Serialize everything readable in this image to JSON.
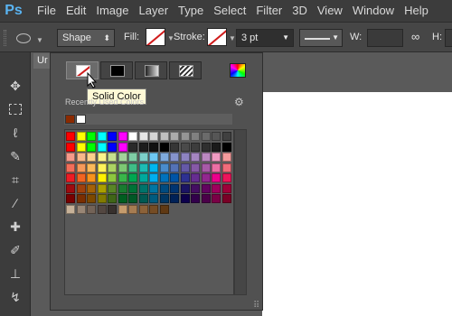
{
  "menubar": {
    "logo": "Ps",
    "items": [
      "File",
      "Edit",
      "Image",
      "Layer",
      "Type",
      "Select",
      "Filter",
      "3D",
      "View",
      "Window",
      "Help"
    ]
  },
  "options": {
    "mode_value": "Shape",
    "fill_label": "Fill:",
    "stroke_label": "Stroke:",
    "stroke_width": "3 pt",
    "w_label": "W:",
    "h_label": "H:"
  },
  "document": {
    "tab_label": "Ur"
  },
  "fill_popup": {
    "fill_types": [
      "No Color",
      "Solid Color",
      "Gradient",
      "Pattern"
    ],
    "tooltip": "Solid Color",
    "recent_label": "Recently Used Colors",
    "recent_colors": [
      "#8b2a00",
      "#ffffff"
    ],
    "swatch_rows": [
      [
        "#ff0000",
        "#ffff00",
        "#00ff00",
        "#00ffff",
        "#0000ff",
        "#ff00ff",
        "#ffffff",
        "#e6e6e6",
        "#d4d4d4",
        "#c0c0c0",
        "#ababab",
        "#959595",
        "#808080",
        "#6b6b6b",
        "#565656",
        "#404040"
      ],
      [
        "#ff0000",
        "#ffff00",
        "#00ff00",
        "#00ffff",
        "#0000ff",
        "#ff00ff",
        "#2a2a2a",
        "#1c1c1c",
        "#111111",
        "#000000",
        "#363636",
        "#4a4a4a",
        "#3d3d3d",
        "#2f2f2f",
        "#1a1a1a",
        "#000000"
      ],
      [
        "#f59a8a",
        "#f8b88a",
        "#fcd18c",
        "#fdf58c",
        "#c7df8f",
        "#a3d49b",
        "#7fcda5",
        "#7ccfc9",
        "#6ec9f4",
        "#7eaadd",
        "#8593cc",
        "#8d83c1",
        "#a485c0",
        "#bb88c0",
        "#f09bc2",
        "#f49b9c"
      ],
      [
        "#f26e5a",
        "#f69a5a",
        "#fbba5a",
        "#fff25a",
        "#acd363",
        "#7dc874",
        "#3fbd87",
        "#1dbcb5",
        "#00b7ef",
        "#4a8ccc",
        "#5472b6",
        "#6559a7",
        "#8659a6",
        "#a75aa7",
        "#eb6fa5",
        "#f06c7a"
      ],
      [
        "#ed1c24",
        "#f26522",
        "#f7941d",
        "#fff200",
        "#8dc63f",
        "#39b54a",
        "#00a651",
        "#00a99d",
        "#00aeef",
        "#0072bc",
        "#0054a6",
        "#2e3192",
        "#662d91",
        "#92278f",
        "#ec008c",
        "#ed145b"
      ],
      [
        "#9e0b0f",
        "#a0410d",
        "#a36209",
        "#aba000",
        "#598527",
        "#197b30",
        "#007236",
        "#00746b",
        "#0076a3",
        "#004b80",
        "#003471",
        "#1b1464",
        "#440e62",
        "#630460",
        "#9e005d",
        "#9e0039"
      ],
      [
        "#790000",
        "#7b2e00",
        "#7d4900",
        "#827b00",
        "#406618",
        "#005e20",
        "#005826",
        "#005952",
        "#005b7f",
        "#003663",
        "#002157",
        "#0d004c",
        "#32004b",
        "#4b0049",
        "#7b0046",
        "#7a0026"
      ],
      [
        "#c7b299",
        "#998675",
        "#736357",
        "#534741",
        "#37302d",
        "#c69c6d",
        "#a67c52",
        "#8c6239",
        "#754c24",
        "#603913"
      ]
    ]
  },
  "colors": {
    "menubar_bg": "#3c3c3c",
    "panel_bg": "#535353",
    "accent_logo": "#5ab4f2",
    "tooltip_bg": "#fff9d6"
  }
}
